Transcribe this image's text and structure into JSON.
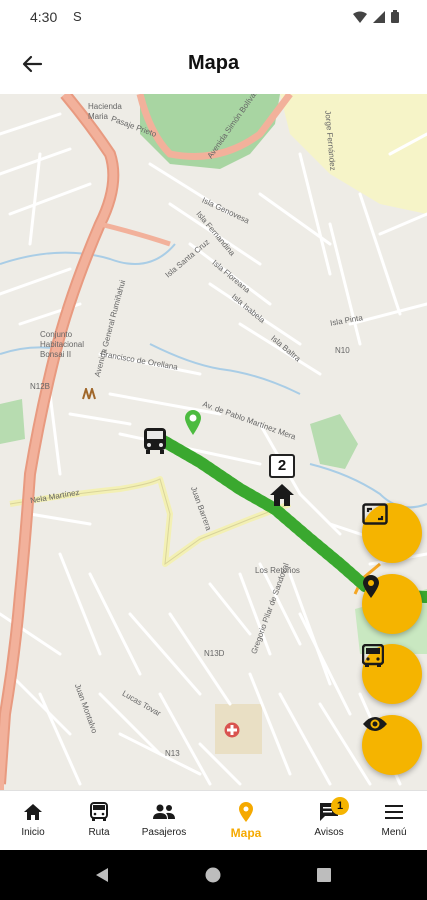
{
  "status": {
    "time": "4:30",
    "indicator": "S"
  },
  "header": {
    "title": "Mapa",
    "back_icon": "arrow-left-icon"
  },
  "map": {
    "labels": [
      "Hacienda Maria",
      "Avenida Simón Bolívar",
      "Jorge Fernández",
      "Avenida General Rumiñahui",
      "Conjunto Habitacional Bonsai II",
      "Francisco de Orellana",
      "Pasaje Prieto",
      "Isla Genovesa",
      "Isla Santa Cruz",
      "Isla Fernandina",
      "Isla Isabela",
      "Isla Baltra",
      "Isla Floreana",
      "Isla Pinta",
      "Av. de Pablo Martínez Mera",
      "Nela Martínez",
      "Juan Barrera",
      "Los Retoños",
      "Gregorio Pilar de Sandoval",
      "Juan Montalvo",
      "Lucas Tovar",
      "N13",
      "N10",
      "N13D",
      "N12B"
    ],
    "marker_number": "2",
    "route_color": "#4cbb3f",
    "connector_color": "#f5a623"
  },
  "fabs": [
    {
      "icon": "fullscreen-icon"
    },
    {
      "icon": "location-pin-icon"
    },
    {
      "icon": "bus-icon"
    },
    {
      "icon": "eye-icon"
    }
  ],
  "nav": {
    "items": [
      {
        "label": "Inicio",
        "icon": "home-icon"
      },
      {
        "label": "Ruta",
        "icon": "bus-icon"
      },
      {
        "label": "Pasajeros",
        "icon": "people-icon"
      },
      {
        "label": "Mapa",
        "icon": "location-pin-icon",
        "active": true
      },
      {
        "label": "Avisos",
        "icon": "chat-icon",
        "badge": "1"
      },
      {
        "label": "Menú",
        "icon": "hamburger-icon"
      }
    ]
  },
  "colors": {
    "accent": "#f5b400",
    "active_nav": "#f5a900"
  }
}
